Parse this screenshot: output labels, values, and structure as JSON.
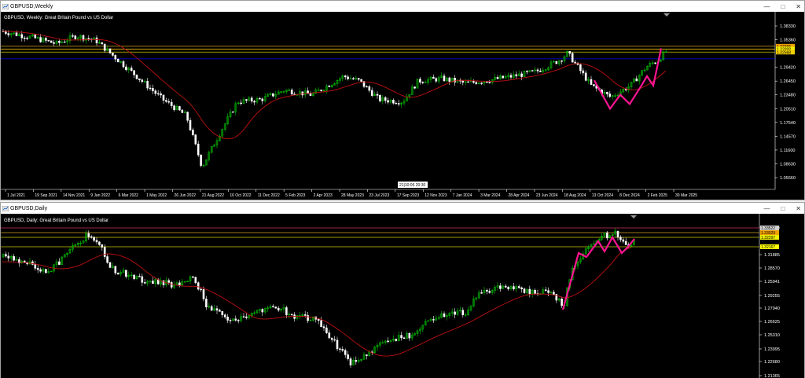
{
  "weekly": {
    "window_title": "GBPUSD,Weekly",
    "chart_label": "GBPUSD, Weekly:  Great Britain Pound vs US Dollar",
    "price_ticks": [
      "1.38330",
      "1.35360",
      "1.29420",
      "1.26450",
      "1.23480",
      "1.20510",
      "1.17540",
      "1.14570",
      "1.11600",
      "1.08630",
      "1.05660"
    ],
    "price_tick_values": [
      1.3833,
      1.3536,
      1.2942,
      1.2645,
      1.2348,
      1.2051,
      1.1754,
      1.1457,
      1.116,
      1.0863,
      1.0566
    ],
    "hlines": [
      {
        "price": 1.3395,
        "color": "#d4a020",
        "label": "1.33366"
      },
      {
        "price": 1.3335,
        "color": "#f0c000",
        "label": "1.32998"
      },
      {
        "price": 1.327,
        "color": "#c8c800",
        "label": "1.32568"
      },
      {
        "price": 1.3125,
        "color": "#0000cc",
        "label": ""
      }
    ],
    "price_badges": [
      {
        "text": "1.33366",
        "bg": "#f0a000",
        "price": 1.3395
      },
      {
        "text": "1.32998",
        "bg": "#f0f000",
        "price": 1.3335
      },
      {
        "text": "1.32568",
        "bg": "#f0d000",
        "price": 1.327
      }
    ],
    "date_ticks": [
      "1 Jul 2021",
      "19 Sep 2021",
      "14 Nov 2021",
      "9 Jan 2022",
      "6 Mar 2022",
      "1 May 2022",
      "26 Jun 2022",
      "21 Aug 2022",
      "16 Oct 2022",
      "11 Dec 2022",
      "5 Feb 2023",
      "2 Apr 2023",
      "28 May 2023",
      "23 Jul 2023",
      "17 Sep 2023",
      "12 Nov 2023",
      "7 Jan 2024",
      "3 Mar 2024",
      "28 Apr 2024",
      "23 Jun 2024",
      "18 Aug 2024",
      "13 Oct 2024",
      "8 Dec 2024",
      "2 Feb 2025",
      "30 Mar 2025"
    ],
    "crosshair_time": "21|10:06",
    "crosshair_clock": "20:30"
  },
  "daily": {
    "window_title": "GBPUSD,Daily",
    "chart_label": "GBPUSD, Daily:  Great Britain Pound vs US Dollar",
    "price_ticks": [
      "1.34515",
      "1.31885",
      "1.28570",
      "1.25941",
      "1.29255",
      "1.27940",
      "1.26625",
      "1.25310",
      "1.23995",
      "1.22680",
      "1.21365"
    ],
    "hlines": [
      {
        "y": 18,
        "color": "#d03060"
      },
      {
        "y": 24,
        "color": "#d4a020"
      },
      {
        "y": 30,
        "color": "#c8c800"
      },
      {
        "y": 42,
        "color": "#c8c800"
      }
    ],
    "price_badges": [
      {
        "text": "1.33522",
        "bg": "#d0d0d0",
        "y": 18
      },
      {
        "text": "1.33029",
        "bg": "#f0a000",
        "y": 24
      },
      {
        "text": "1.32297",
        "bg": "#f0f000",
        "y": 30
      },
      {
        "text": "1.32167",
        "bg": "#ffff00",
        "y": 42
      }
    ]
  },
  "colors": {
    "bull": "#00c000",
    "bear": "#ffffff",
    "ma": "#c01010",
    "zigzag": "#ff1493",
    "axis_text": "#ffffff"
  }
}
